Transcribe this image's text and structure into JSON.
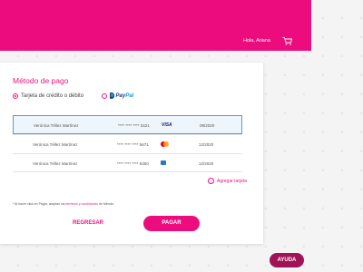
{
  "header": {
    "greeting": "Hola, Ariana",
    "cart_icon": "shopping-cart-icon",
    "color": "#ec0c7d"
  },
  "payment": {
    "title": "Método de pago",
    "options": {
      "card_label": "Tarjeta de crédito o débito",
      "paypal_left": "Pay",
      "paypal_right": "Pal"
    },
    "cards": [
      {
        "name": "Verónica Téllez Martínez",
        "number": "**** **** **** 3421",
        "brand": "VISA",
        "expiry": "09/2020"
      },
      {
        "name": "Verónica Téllez Martínez",
        "number": "**** **** **** 5671",
        "brand": "mastercard",
        "expiry": "12/2020"
      },
      {
        "name": "Verónica Téllez Martínez",
        "number": "**** **** **** 6350",
        "brand": "amex",
        "expiry": "12/2020"
      }
    ],
    "add_card_label": "Agregar tarjeta",
    "terms": {
      "prefix": "* Al hacer click en Pagar, aceptas los",
      "link": "términos y condiciones",
      "suffix": "de Mimoto"
    },
    "back_label": "REGRESAR",
    "pay_label": "PAGAR"
  },
  "help_label": "AYUDA"
}
